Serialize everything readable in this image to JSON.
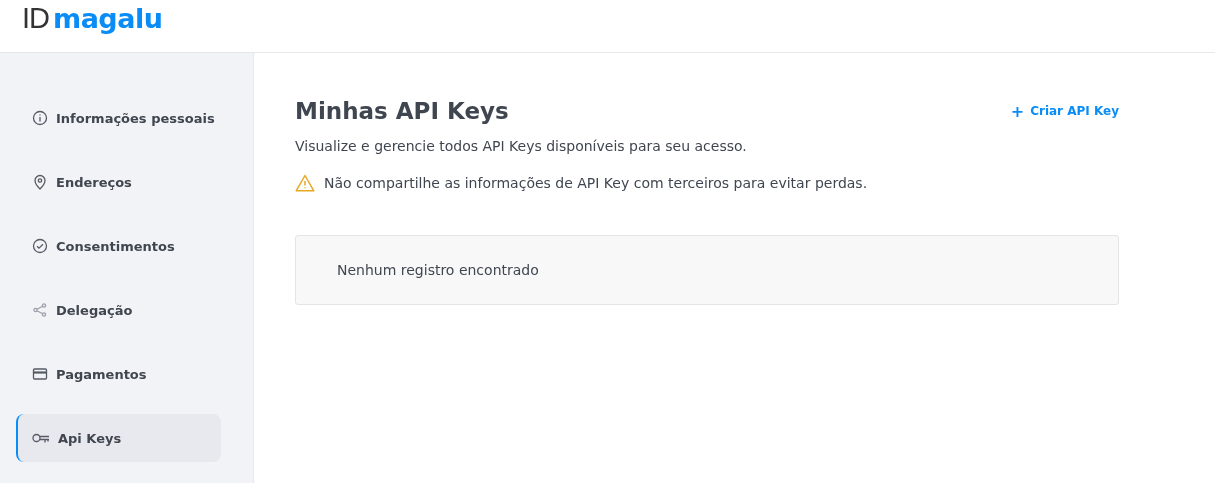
{
  "header": {
    "logo": {
      "prefix": "ID",
      "brand": "magalu"
    }
  },
  "sidebar": {
    "items": [
      {
        "label": "Informações pessoais",
        "selected": false
      },
      {
        "label": "Endereços",
        "selected": false
      },
      {
        "label": "Consentimentos",
        "selected": false
      },
      {
        "label": "Delegação",
        "selected": false
      },
      {
        "label": "Pagamentos",
        "selected": false
      },
      {
        "label": "Api Keys",
        "selected": true
      }
    ]
  },
  "main": {
    "title": "Minhas API Keys",
    "create_button": {
      "icon": "+",
      "label": "Criar API Key"
    },
    "description": "Visualize e gerencie todos API Keys disponíveis para seu acesso.",
    "warning": "Não compartilhe as informações de API Key com terceiros para evitar perdas.",
    "empty_message": "Nenhum registro encontrado"
  }
}
